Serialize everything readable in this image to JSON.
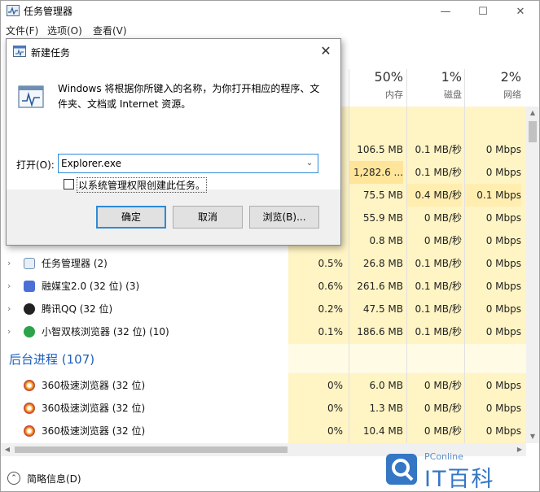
{
  "window": {
    "title": "任务管理器",
    "minimize": "—",
    "maximize": "☐",
    "close": "✕"
  },
  "menu": [
    "文件(F)",
    "选项(O)",
    "查看(V)"
  ],
  "columns": [
    {
      "pct": "50%",
      "label": "内存"
    },
    {
      "pct": "1%",
      "label": "磁盘"
    },
    {
      "pct": "2%",
      "label": "网络"
    }
  ],
  "partial_rows": [
    {
      "mem": "106.5 MB",
      "disk": "0.1 MB/秒",
      "net": "0 Mbps"
    },
    {
      "mem": "1,282.6 ...",
      "disk": "0.1 MB/秒",
      "net": "0 Mbps"
    },
    {
      "mem": "75.5 MB",
      "disk": "0.4 MB/秒",
      "net": "0.1 Mbps"
    },
    {
      "mem": "55.9 MB",
      "disk": "0 MB/秒",
      "net": "0 Mbps"
    },
    {
      "mem": "0.8 MB",
      "disk": "0 MB/秒",
      "net": "0 Mbps"
    }
  ],
  "app_rows": [
    {
      "name": "任务管理器 (2)",
      "icon": "task-manager-icon",
      "color": "#6d8fb3",
      "cpu": "0.5%",
      "mem": "26.8 MB",
      "disk": "0.1 MB/秒",
      "net": "0 Mbps"
    },
    {
      "name": "融媒宝2.0 (32 位) (3)",
      "icon": "rongmeibao-icon",
      "color": "#4a6fd6",
      "cpu": "0.6%",
      "mem": "261.6 MB",
      "disk": "0.1 MB/秒",
      "net": "0 Mbps"
    },
    {
      "name": "腾讯QQ (32 位)",
      "icon": "qq-icon",
      "color": "#222222",
      "cpu": "0.2%",
      "mem": "47.5 MB",
      "disk": "0.1 MB/秒",
      "net": "0 Mbps"
    },
    {
      "name": "小智双核浏览器 (32 位) (10)",
      "icon": "browser-icon",
      "color": "#2aa34a",
      "cpu": "0.1%",
      "mem": "186.6 MB",
      "disk": "0.1 MB/秒",
      "net": "0 Mbps"
    }
  ],
  "background_section": "后台进程 (107)",
  "bg_rows": [
    {
      "name": "360极速浏览器 (32 位)",
      "cpu": "0%",
      "mem": "6.0 MB",
      "disk": "0 MB/秒",
      "net": "0 Mbps"
    },
    {
      "name": "360极速浏览器 (32 位)",
      "cpu": "0%",
      "mem": "1.3 MB",
      "disk": "0 MB/秒",
      "net": "0 Mbps"
    },
    {
      "name": "360极速浏览器 (32 位)",
      "cpu": "0%",
      "mem": "10.4 MB",
      "disk": "0 MB/秒",
      "net": "0 Mbps"
    }
  ],
  "status": {
    "text": "简略信息(D)"
  },
  "watermark": {
    "small": "PConline",
    "big": "IT百科"
  },
  "dialog": {
    "title": "新建任务",
    "close": "✕",
    "description": "Windows 将根据你所键入的名称，为你打开相应的程序、文件夹、文档或 Internet 资源。",
    "open_label": "打开(O):",
    "open_value": "Explorer.exe",
    "checkbox_label": "以系统管理权限创建此任务。",
    "ok": "确定",
    "cancel": "取消",
    "browse": "浏览(B)..."
  },
  "colors": {
    "heat": "#fff4c4",
    "section": "#1f5fbf",
    "accent": "#2f8ad6"
  }
}
